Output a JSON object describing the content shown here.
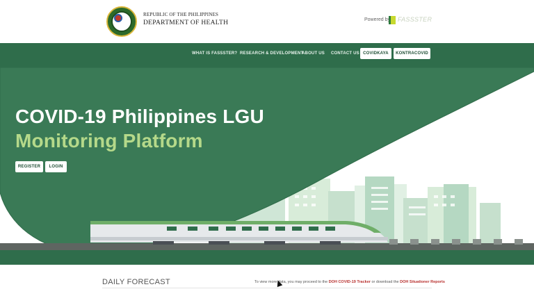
{
  "header": {
    "org_line1": "REPUBLIC OF THE PHILIPPINES",
    "org_line2": "DEPARTMENT OF HEALTH",
    "seal_icon": "doh-seal-icon",
    "powered_by": "Powered by",
    "brand_name": "FASSSTER"
  },
  "nav": {
    "items": [
      {
        "label": "WHAT IS FASSSTER?"
      },
      {
        "label": "RESEARCH & DEVELOPMENT"
      },
      {
        "label": "ABOUT US"
      },
      {
        "label": "CONTACT US"
      }
    ],
    "buttons": [
      {
        "label": "COVIDKAYA"
      },
      {
        "label": "KONTRACOVID"
      }
    ]
  },
  "hero": {
    "title_line1": "COVID-19 Philippines LGU",
    "title_line2": "Monitoring Platform",
    "register_label": "REGISTER",
    "login_label": "LOGIN"
  },
  "forecast": {
    "heading": "DAILY FORECAST",
    "note_prefix": "To view more data, you may proceed to the",
    "tracker_link": "DOH COVID-19 Tracker",
    "note_middle": "or download the",
    "reports_link": "DOH Situationer Reports"
  },
  "colors": {
    "nav_green": "#2f6d4b",
    "hero_green": "#3a7a56",
    "title_accent": "#b5d98a",
    "link_red": "#b8312f"
  }
}
